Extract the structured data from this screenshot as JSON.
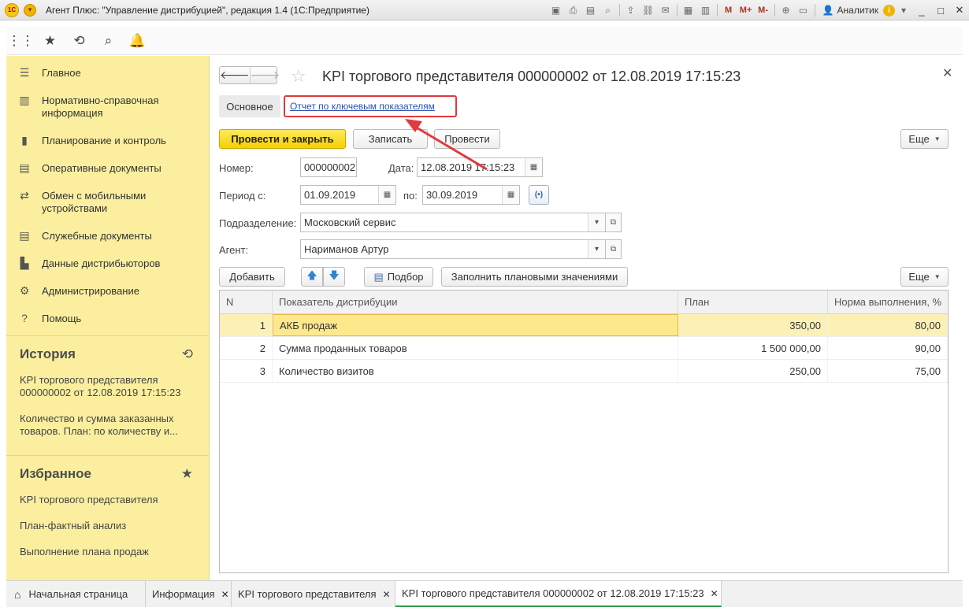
{
  "window": {
    "title": "Агент Плюс: \"Управление дистрибуцией\", редакция 1.4  (1С:Предприятие)",
    "logo_text": "1С",
    "user": "Аналитик",
    "toolbar_m": "M",
    "toolbar_mplus": "M+",
    "toolbar_mminus": "M-"
  },
  "sidebar": {
    "items": [
      {
        "label": "Главное",
        "icon": "menu-icon"
      },
      {
        "label": "Нормативно-справочная информация",
        "icon": "reference-icon"
      },
      {
        "label": "Планирование и контроль",
        "icon": "chart-icon"
      },
      {
        "label": "Оперативные документы",
        "icon": "documents-icon"
      },
      {
        "label": "Обмен с мобильными устройствами",
        "icon": "mobile-icon"
      },
      {
        "label": "Служебные документы",
        "icon": "documents-icon"
      },
      {
        "label": "Данные дистрибьюторов",
        "icon": "distributor-icon"
      },
      {
        "label": "Администрирование",
        "icon": "gear-icon"
      },
      {
        "label": "Помощь",
        "icon": "help-icon"
      }
    ],
    "history": {
      "title": "История",
      "items": [
        "KPI торгового представителя 000000002 от 12.08.2019 17:15:23",
        "Количество и сумма заказанных товаров.    План: по количеству и..."
      ]
    },
    "favorites": {
      "title": "Избранное",
      "items": [
        "KPI торгового представителя",
        "План-фактный анализ",
        "Выполнение плана продаж"
      ]
    }
  },
  "form": {
    "title": "KPI торгового представителя 000000002 от 12.08.2019 17:15:23",
    "tabs": {
      "basic": "Основное",
      "report_link": "Отчет по ключевым показателям"
    },
    "buttons": {
      "post_close": "Провести и закрыть",
      "save": "Записать",
      "post": "Провести",
      "more": "Еще",
      "add": "Добавить",
      "pick": "Подбор",
      "fill_plan": "Заполнить плановыми значениями"
    },
    "fields": {
      "number_label": "Номер:",
      "number_value": "000000002",
      "date_label": "Дата:",
      "date_value": "12.08.2019 17:15:23",
      "period_from_label": "Период с:",
      "period_from_value": "01.09.2019",
      "period_to_label": "по:",
      "period_to_value": "30.09.2019",
      "division_label": "Подразделение:",
      "division_value": "Московский сервис",
      "agent_label": "Агент:",
      "agent_value": "Нариманов Артур"
    },
    "table": {
      "columns": [
        "N",
        "Показатель дистрибуции",
        "План",
        "Норма выполнения, %"
      ],
      "rows": [
        {
          "n": "1",
          "indicator": "АКБ продаж",
          "plan": "350,00",
          "norm": "80,00"
        },
        {
          "n": "2",
          "indicator": "Сумма проданных товаров",
          "plan": "1 500 000,00",
          "norm": "90,00"
        },
        {
          "n": "3",
          "indicator": "Количество визитов",
          "plan": "250,00",
          "norm": "75,00"
        }
      ]
    }
  },
  "bottom_tabs": [
    {
      "label": "Начальная страница"
    },
    {
      "label": "Информация"
    },
    {
      "label": "KPI торгового представителя"
    },
    {
      "label": "KPI торгового представителя 000000002 от 12.08.2019 17:15:23"
    }
  ],
  "colors": {
    "sidebar_bg": "#fbef9f",
    "primary_button": "#f5d000",
    "link": "#2a4fb0",
    "annotation": "#e0393e",
    "active_tab_underline": "#2e9d4b"
  }
}
